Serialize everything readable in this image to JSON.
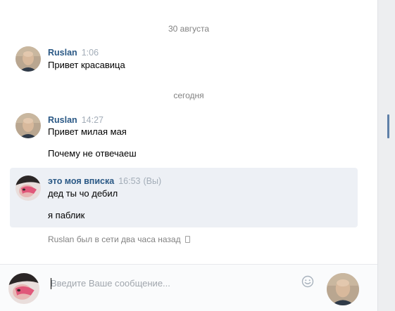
{
  "dates": {
    "first": "30 августа",
    "second": "сегодня"
  },
  "messages": [
    {
      "author": "Ruslan",
      "time": "1:06",
      "texts": [
        "Привет красавица"
      ]
    },
    {
      "author": "Ruslan",
      "time": "14:27",
      "texts": [
        "Привет милая мая",
        "Почему не отвечаеш"
      ]
    },
    {
      "author": "это моя вписка",
      "time": "16:53",
      "you_marker": "(Вы)",
      "texts": [
        "дед ты чо дебил",
        "я паблик"
      ]
    }
  ],
  "status": {
    "text": "Ruslan был в сети два часа назад",
    "icon": "mobile-phone-icon"
  },
  "composer": {
    "placeholder": "Введите Ваше сообщение...",
    "emoji_icon": "smile-icon"
  },
  "colors": {
    "author": "#2a5885",
    "time": "#a3adb8",
    "highlight": "#edf0f5",
    "scroll_thumb": "#5f80a8"
  }
}
